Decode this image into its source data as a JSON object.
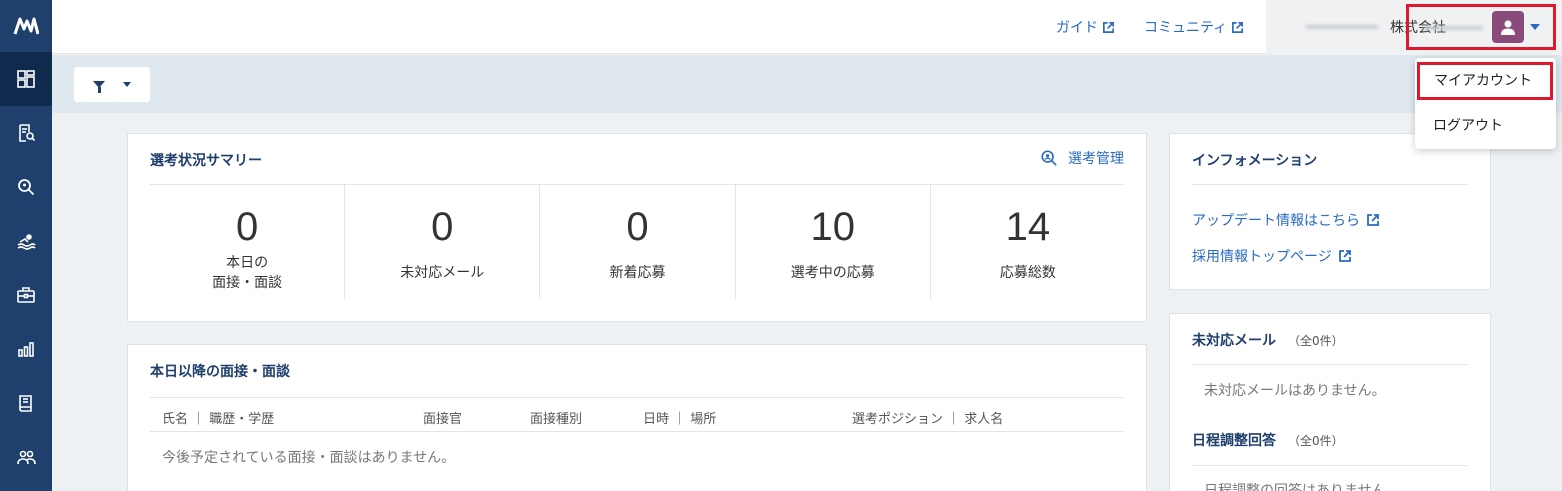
{
  "sidebar": {
    "logo": "M",
    "items": [
      {
        "icon": "dashboard-icon"
      },
      {
        "icon": "document-search-icon"
      },
      {
        "icon": "search-icon"
      },
      {
        "icon": "swimmer-icon"
      },
      {
        "icon": "briefcase-icon"
      },
      {
        "icon": "bar-chart-icon"
      },
      {
        "icon": "book-icon"
      },
      {
        "icon": "users-icon"
      }
    ]
  },
  "header": {
    "guide_label": "ガイド",
    "community_label": "コミュニティ",
    "company_suffix": "株式会社"
  },
  "account_menu": {
    "my_account": "マイアカウント",
    "logout": "ログアウト"
  },
  "summary": {
    "title": "選考状況サマリー",
    "manage_link": "選考管理",
    "stats": [
      {
        "value": "0",
        "label": "本日の\n面接・面談"
      },
      {
        "value": "0",
        "label": "未対応メール"
      },
      {
        "value": "0",
        "label": "新着応募"
      },
      {
        "value": "10",
        "label": "選考中の応募"
      },
      {
        "value": "14",
        "label": "応募総数"
      }
    ]
  },
  "interviews": {
    "title": "本日以降の面接・面談",
    "columns": [
      "氏名 ｜ 職歴・学歴",
      "面接官",
      "面接種別",
      "日時 ｜ 場所",
      "選考ポジション ｜ 求人名"
    ],
    "empty": "今後予定されている面接・面談はありません。"
  },
  "information": {
    "title": "インフォメーション",
    "links": [
      "アップデート情報はこちら",
      "採用情報トップページ"
    ]
  },
  "unhandled_mail": {
    "title": "未対応メール",
    "count": "（全0件）",
    "empty": "未対応メールはありません。"
  },
  "schedule_replies": {
    "title": "日程調整回答",
    "count": "（全0件）",
    "empty": "日程調整の回答はありません。"
  },
  "colors": {
    "sidebar": "#1f3f6c",
    "link": "#2a6ac4",
    "highlight_border": "#e0182d"
  }
}
